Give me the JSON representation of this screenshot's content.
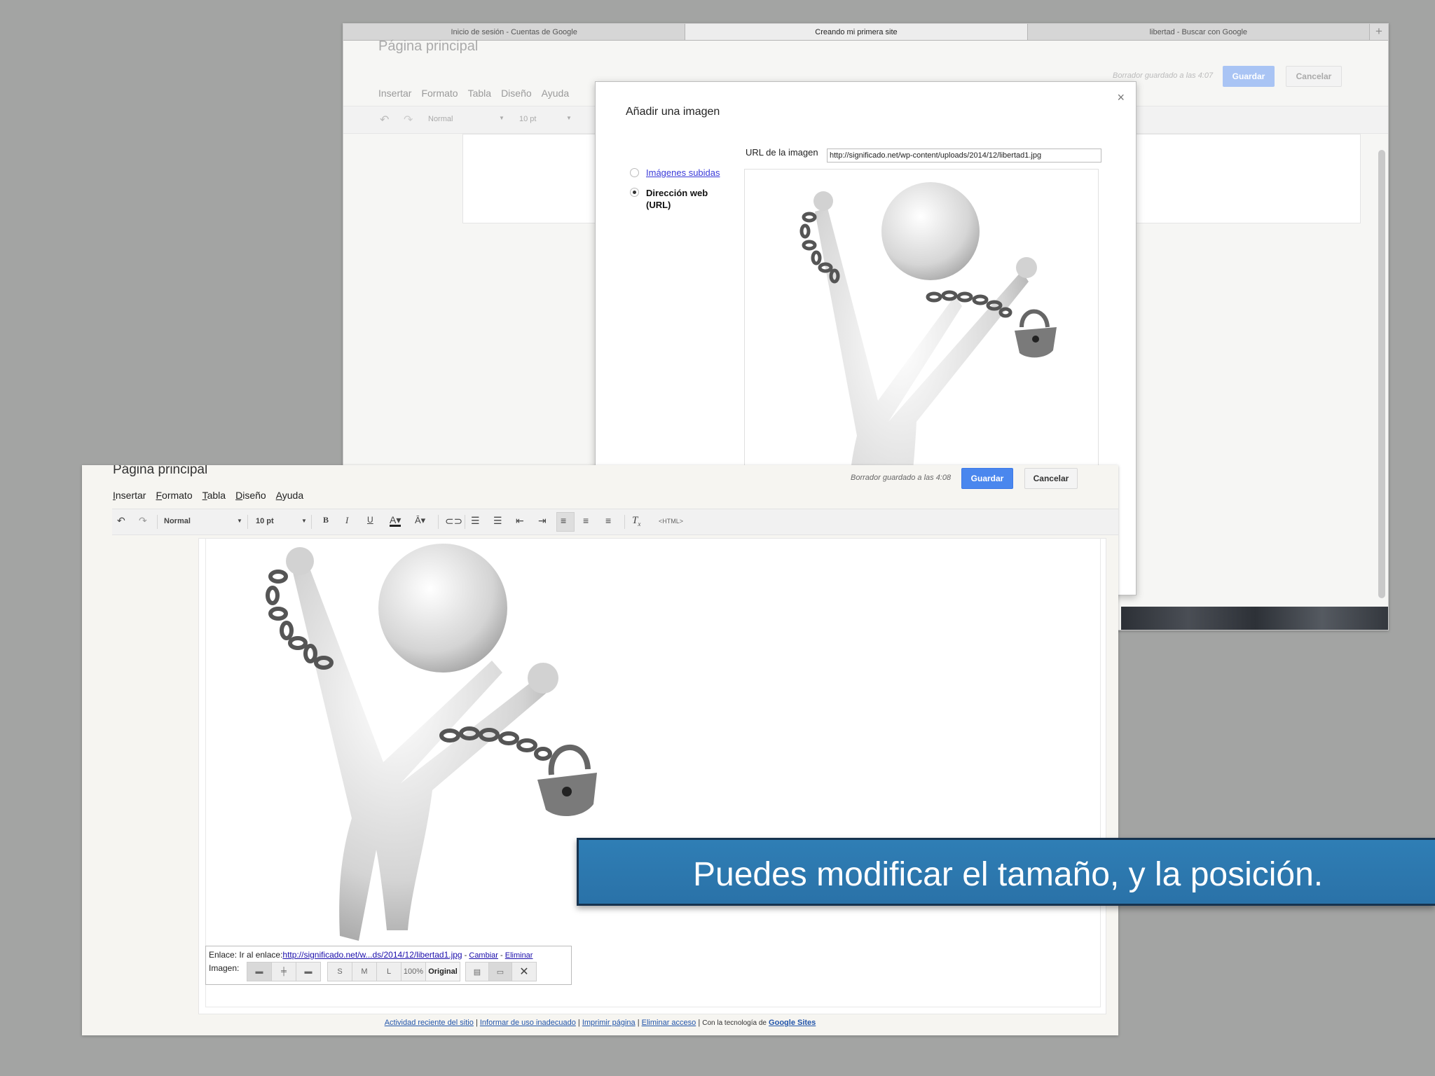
{
  "back_window": {
    "tabs": [
      "Inicio de sesión - Cuentas de Google",
      "Creando mi primera site",
      "libertad - Buscar con Google"
    ],
    "new_tab": "+",
    "page_title": "Página principal",
    "menu": [
      "Insertar",
      "Formato",
      "Tabla",
      "Diseño",
      "Ayuda"
    ],
    "draft_status": "Borrador guardado a las 4:07",
    "save_label": "Guardar",
    "cancel_label": "Cancelar",
    "toolbar": {
      "style": "Normal",
      "size": "10 pt"
    }
  },
  "dialog": {
    "title": "Añadir una imagen",
    "close": "×",
    "option_uploaded": "Imágenes subidas",
    "option_url": "Dirección web (URL)",
    "url_label": "URL de la imagen",
    "url_value": "http://significado.net/wp-content/uploads/2014/12/libertad1.jpg"
  },
  "front_window": {
    "page_title": "Página principal",
    "menu": [
      "Insertar",
      "Formato",
      "Tabla",
      "Diseño",
      "Ayuda"
    ],
    "draft_status": "Borrador guardado a las 4:08",
    "save_label": "Guardar",
    "cancel_label": "Cancelar",
    "toolbar": {
      "style": "Normal",
      "size": "10 pt",
      "bold": "B",
      "italic": "I",
      "underline": "U",
      "html": "<HTML>"
    },
    "image_bubble": {
      "link_label": "Enlace:",
      "go_to_link": "Ir al enlace:",
      "link_url": "http://significado.net/w...ds/2014/12/libertad1.jpg",
      "dash1": " - ",
      "change": "Cambiar",
      "dash2": " - ",
      "remove": "Eliminar",
      "image_label": "Imagen:",
      "size_s": "S",
      "size_m": "M",
      "size_l": "L",
      "size_100": "100%",
      "size_original": "Original"
    },
    "footer": {
      "recent_activity": "Actividad reciente del sitio",
      "report_abuse": "Informar de uso inadecuado",
      "print_page": "Imprimir página",
      "remove_access": "Eliminar acceso",
      "powered_by": "Con la tecnología de",
      "google_sites": "Google Sites"
    }
  },
  "caption": "Puedes modificar el tamaño, y la posición.",
  "colors": {
    "save_button": "#4a87ee",
    "banner": "#2f7eb5",
    "background": "#a3a4a3"
  }
}
